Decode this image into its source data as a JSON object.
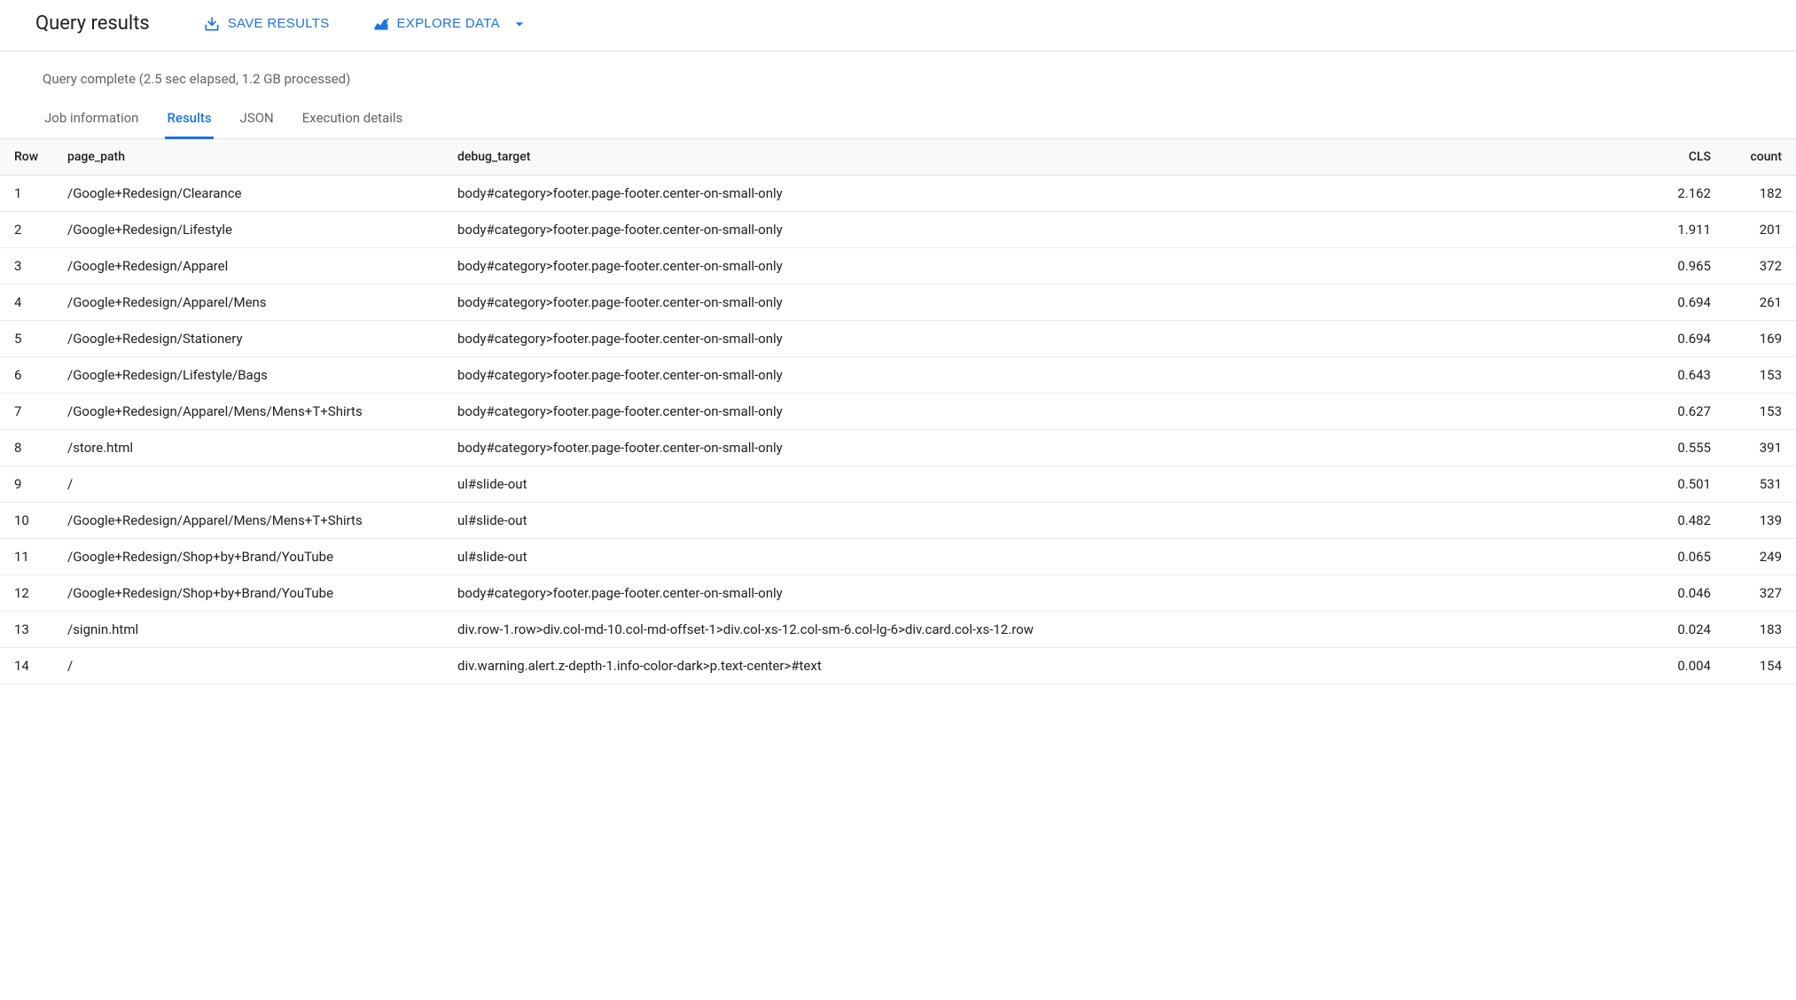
{
  "header": {
    "title": "Query results",
    "save_label": "SAVE RESULTS",
    "explore_label": "EXPLORE DATA"
  },
  "status": "Query complete (2.5 sec elapsed, 1.2 GB processed)",
  "tabs": [
    {
      "label": "Job information",
      "active": false
    },
    {
      "label": "Results",
      "active": true
    },
    {
      "label": "JSON",
      "active": false
    },
    {
      "label": "Execution details",
      "active": false
    }
  ],
  "columns": {
    "row": "Row",
    "page_path": "page_path",
    "debug_target": "debug_target",
    "cls": "CLS",
    "count": "count"
  },
  "rows": [
    {
      "n": "1",
      "page_path": "/Google+Redesign/Clearance",
      "debug_target": "body#category>footer.page-footer.center-on-small-only",
      "cls": "2.162",
      "count": "182"
    },
    {
      "n": "2",
      "page_path": "/Google+Redesign/Lifestyle",
      "debug_target": "body#category>footer.page-footer.center-on-small-only",
      "cls": "1.911",
      "count": "201"
    },
    {
      "n": "3",
      "page_path": "/Google+Redesign/Apparel",
      "debug_target": "body#category>footer.page-footer.center-on-small-only",
      "cls": "0.965",
      "count": "372"
    },
    {
      "n": "4",
      "page_path": "/Google+Redesign/Apparel/Mens",
      "debug_target": "body#category>footer.page-footer.center-on-small-only",
      "cls": "0.694",
      "count": "261"
    },
    {
      "n": "5",
      "page_path": "/Google+Redesign/Stationery",
      "debug_target": "body#category>footer.page-footer.center-on-small-only",
      "cls": "0.694",
      "count": "169"
    },
    {
      "n": "6",
      "page_path": "/Google+Redesign/Lifestyle/Bags",
      "debug_target": "body#category>footer.page-footer.center-on-small-only",
      "cls": "0.643",
      "count": "153"
    },
    {
      "n": "7",
      "page_path": "/Google+Redesign/Apparel/Mens/Mens+T+Shirts",
      "debug_target": "body#category>footer.page-footer.center-on-small-only",
      "cls": "0.627",
      "count": "153"
    },
    {
      "n": "8",
      "page_path": "/store.html",
      "debug_target": "body#category>footer.page-footer.center-on-small-only",
      "cls": "0.555",
      "count": "391"
    },
    {
      "n": "9",
      "page_path": "/",
      "debug_target": "ul#slide-out",
      "cls": "0.501",
      "count": "531"
    },
    {
      "n": "10",
      "page_path": "/Google+Redesign/Apparel/Mens/Mens+T+Shirts",
      "debug_target": "ul#slide-out",
      "cls": "0.482",
      "count": "139"
    },
    {
      "n": "11",
      "page_path": "/Google+Redesign/Shop+by+Brand/YouTube",
      "debug_target": "ul#slide-out",
      "cls": "0.065",
      "count": "249"
    },
    {
      "n": "12",
      "page_path": "/Google+Redesign/Shop+by+Brand/YouTube",
      "debug_target": "body#category>footer.page-footer.center-on-small-only",
      "cls": "0.046",
      "count": "327"
    },
    {
      "n": "13",
      "page_path": "/signin.html",
      "debug_target": "div.row-1.row>div.col-md-10.col-md-offset-1>div.col-xs-12.col-sm-6.col-lg-6>div.card.col-xs-12.row",
      "cls": "0.024",
      "count": "183"
    },
    {
      "n": "14",
      "page_path": "/",
      "debug_target": "div.warning.alert.z-depth-1.info-color-dark>p.text-center>#text",
      "cls": "0.004",
      "count": "154"
    }
  ]
}
